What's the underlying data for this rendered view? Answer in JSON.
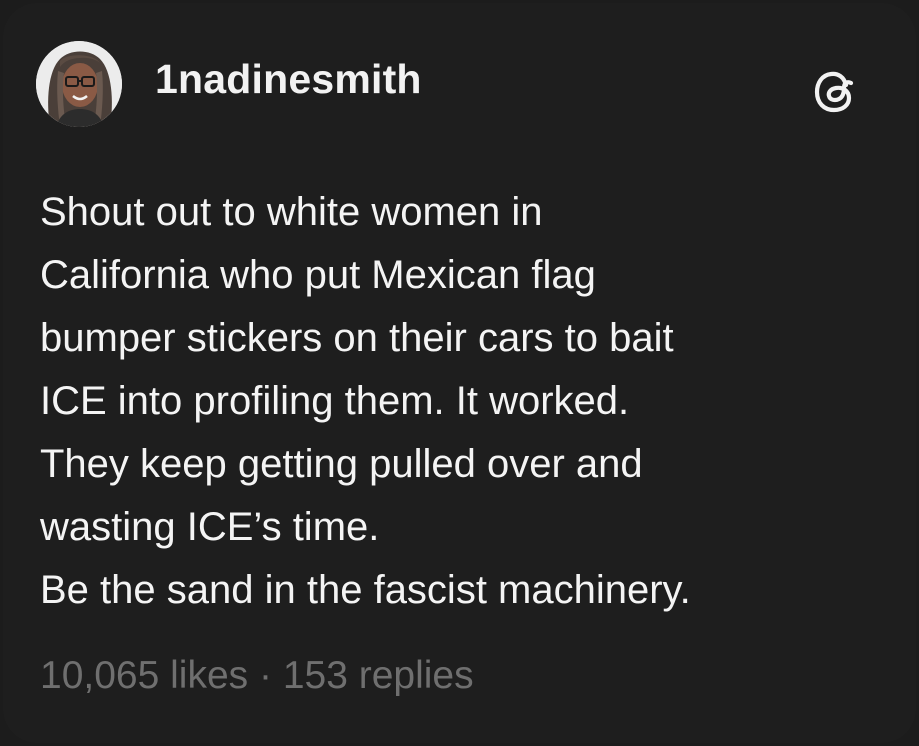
{
  "post": {
    "username": "1nadinesmith",
    "text_lines": [
      "Shout out to white women in",
      "California who put Mexican flag",
      "bumper stickers on their cars to bait",
      "ICE into profiling them. It worked.",
      "They keep getting pulled over and",
      "wasting ICE’s time.",
      "Be the sand in the fascist machinery."
    ],
    "likes": "10,065 likes",
    "separator": " · ",
    "replies": "153 replies"
  },
  "icons": {
    "avatar": "profile-photo",
    "logo": "threads-logo-icon"
  },
  "colors": {
    "background": "#1e1e1e",
    "text": "#f4f4f4",
    "muted": "#6f6f6f"
  }
}
